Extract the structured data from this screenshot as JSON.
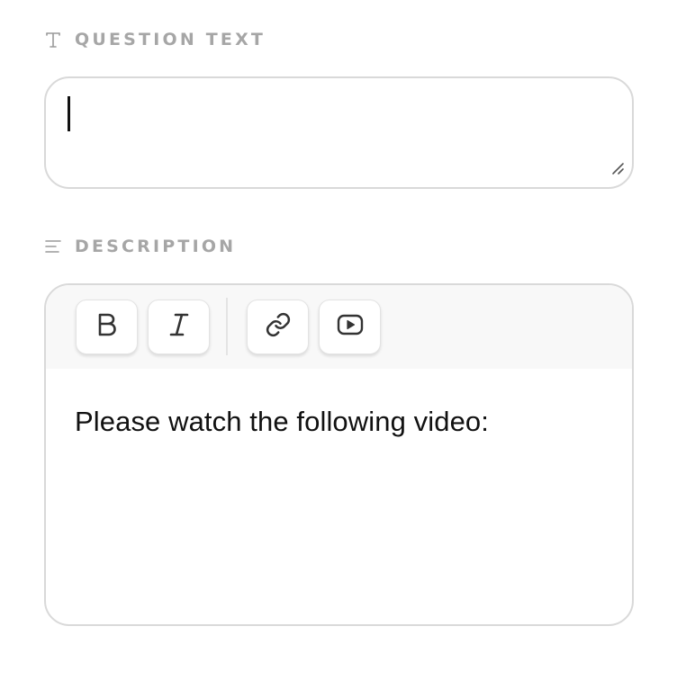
{
  "question_text": {
    "label": "QUESTION TEXT",
    "label_icon": "text-type-icon",
    "value": ""
  },
  "description": {
    "label": "DESCRIPTION",
    "label_icon": "align-left-icon",
    "toolbar": {
      "bold_icon": "bold-icon",
      "italic_icon": "italic-icon",
      "link_icon": "link-icon",
      "video_icon": "video-icon"
    },
    "content": "Please watch the following video:"
  },
  "colors": {
    "label": "#a6a6a6",
    "border": "#d9d9d9",
    "toolbar_bg": "#f8f8f8",
    "text": "#111111"
  }
}
